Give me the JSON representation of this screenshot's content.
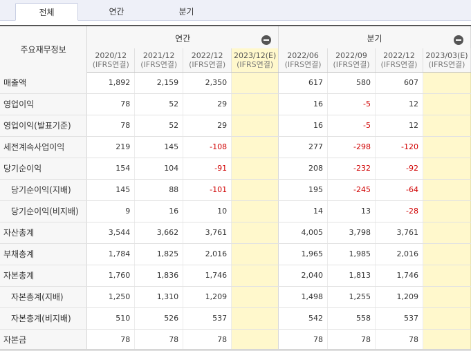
{
  "tabs": [
    {
      "label": "전체",
      "active": true
    },
    {
      "label": "연간",
      "active": false
    },
    {
      "label": "분기",
      "active": false
    }
  ],
  "table": {
    "title": "주요재무정보",
    "groups": {
      "annual": "연간",
      "quarter": "분기"
    },
    "columns": [
      {
        "period": "2020/12",
        "basis": "(IFRS연결)"
      },
      {
        "period": "2021/12",
        "basis": "(IFRS연결)"
      },
      {
        "period": "2022/12",
        "basis": "(IFRS연결)"
      },
      {
        "period": "2023/12(E)",
        "basis": "(IFRS연결)"
      },
      {
        "period": "2022/06",
        "basis": "(IFRS연결)"
      },
      {
        "period": "2022/09",
        "basis": "(IFRS연결)"
      },
      {
        "period": "2022/12",
        "basis": "(IFRS연결)"
      },
      {
        "period": "2023/03(E)",
        "basis": "(IFRS연결)"
      }
    ],
    "rows": [
      {
        "label": "매출액",
        "sub": false,
        "values": [
          "1,892",
          "2,159",
          "2,350",
          "",
          "617",
          "580",
          "607",
          ""
        ]
      },
      {
        "label": "영업이익",
        "sub": false,
        "values": [
          "78",
          "52",
          "29",
          "",
          "16",
          "-5",
          "12",
          ""
        ]
      },
      {
        "label": "영업이익(발표기준)",
        "sub": false,
        "values": [
          "78",
          "52",
          "29",
          "",
          "16",
          "-5",
          "12",
          ""
        ]
      },
      {
        "label": "세전계속사업이익",
        "sub": false,
        "values": [
          "219",
          "145",
          "-108",
          "",
          "277",
          "-298",
          "-120",
          ""
        ]
      },
      {
        "label": "당기순이익",
        "sub": false,
        "values": [
          "154",
          "104",
          "-91",
          "",
          "208",
          "-232",
          "-92",
          ""
        ]
      },
      {
        "label": "당기순이익(지배)",
        "sub": true,
        "values": [
          "145",
          "88",
          "-101",
          "",
          "195",
          "-245",
          "-64",
          ""
        ]
      },
      {
        "label": "당기순이익(비지배)",
        "sub": true,
        "values": [
          "9",
          "16",
          "10",
          "",
          "14",
          "13",
          "-28",
          ""
        ]
      },
      {
        "label": "자산총계",
        "sub": false,
        "values": [
          "3,544",
          "3,662",
          "3,761",
          "",
          "4,005",
          "3,798",
          "3,761",
          ""
        ]
      },
      {
        "label": "부채총계",
        "sub": false,
        "values": [
          "1,784",
          "1,825",
          "2,016",
          "",
          "1,965",
          "1,985",
          "2,016",
          ""
        ]
      },
      {
        "label": "자본총계",
        "sub": false,
        "values": [
          "1,760",
          "1,836",
          "1,746",
          "",
          "2,040",
          "1,813",
          "1,746",
          ""
        ]
      },
      {
        "label": "자본총계(지배)",
        "sub": true,
        "values": [
          "1,250",
          "1,310",
          "1,209",
          "",
          "1,498",
          "1,255",
          "1,209",
          ""
        ]
      },
      {
        "label": "자본총계(비지배)",
        "sub": true,
        "values": [
          "510",
          "526",
          "537",
          "",
          "542",
          "558",
          "537",
          ""
        ]
      },
      {
        "label": "자본금",
        "sub": false,
        "values": [
          "78",
          "78",
          "78",
          "",
          "78",
          "78",
          "78",
          ""
        ]
      }
    ]
  },
  "colors": {
    "negative": "#d00000",
    "estimate_bg": "#fff8cc",
    "header_bg": "#f7f7f7",
    "tabbar_bg": "#eef0f8"
  },
  "icons": {
    "collapse": "minus-circle-icon"
  }
}
